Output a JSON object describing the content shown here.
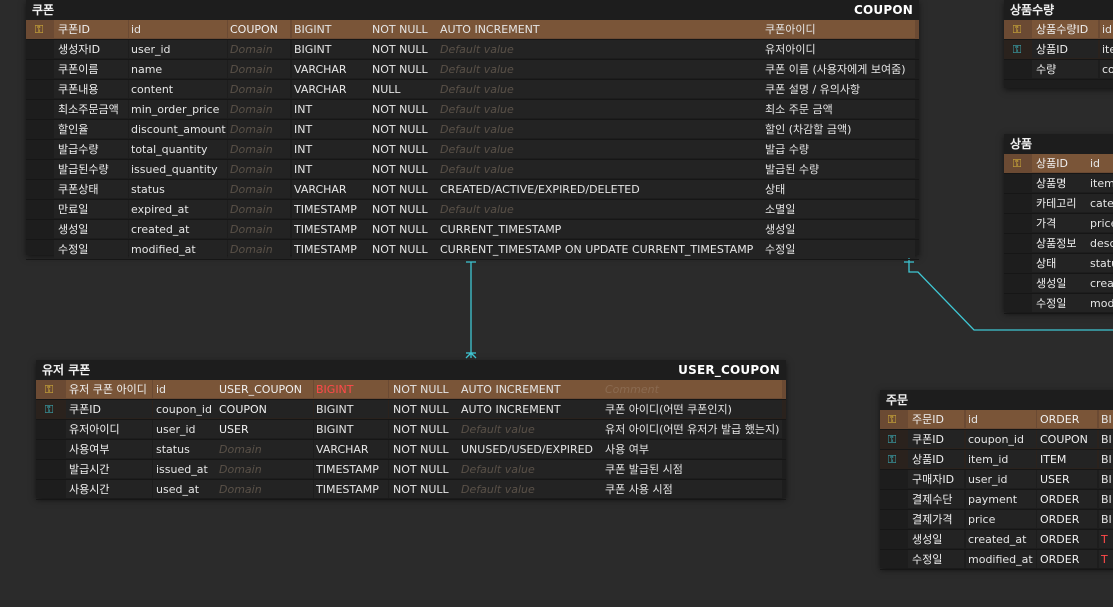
{
  "coupon": {
    "physical": "쿠폰",
    "logical": "COUPON",
    "rows": [
      {
        "key": "pk",
        "ph": "쿠폰ID",
        "col": "id",
        "dom": "COUPON",
        "type": "BIGINT",
        "nn": "NOT NULL",
        "def": "AUTO INCREMENT",
        "cmt": "쿠폰아이디"
      },
      {
        "key": "",
        "ph": "생성자ID",
        "col": "user_id",
        "dom": "Domain",
        "type": "BIGINT",
        "nn": "NOT NULL",
        "def": "Default value",
        "cmt": "유저아이디"
      },
      {
        "key": "",
        "ph": "쿠폰이름",
        "col": "name",
        "dom": "Domain",
        "type": "VARCHAR",
        "nn": "NOT NULL",
        "def": "Default value",
        "cmt": "쿠폰 이름 (사용자에게 보여줌)"
      },
      {
        "key": "",
        "ph": "쿠폰내용",
        "col": "content",
        "dom": "Domain",
        "type": "VARCHAR",
        "nn": "NULL",
        "def": "Default value",
        "cmt": "쿠폰 설명 / 유의사항"
      },
      {
        "key": "",
        "ph": "최소주문금액",
        "col": "min_order_price",
        "dom": "Domain",
        "type": "INT",
        "nn": "NOT NULL",
        "def": "Default value",
        "cmt": "최소 주문 금액"
      },
      {
        "key": "",
        "ph": "할인율",
        "col": "discount_amount",
        "dom": "Domain",
        "type": "INT",
        "nn": "NOT NULL",
        "def": "Default value",
        "cmt": "할인 (차감할 금액)"
      },
      {
        "key": "",
        "ph": "발급수량",
        "col": "total_quantity",
        "dom": "Domain",
        "type": "INT",
        "nn": "NOT NULL",
        "def": "Default value",
        "cmt": "발급 수량"
      },
      {
        "key": "",
        "ph": "발급된수량",
        "col": "issued_quantity",
        "dom": "Domain",
        "type": "INT",
        "nn": "NOT NULL",
        "def": "Default value",
        "cmt": "발급된 수량"
      },
      {
        "key": "",
        "ph": "쿠폰상태",
        "col": "status",
        "dom": "Domain",
        "type": "VARCHAR",
        "nn": "NOT NULL",
        "def": "CREATED/ACTIVE/EXPIRED/DELETED",
        "cmt": "상태"
      },
      {
        "key": "",
        "ph": "만료일",
        "col": "expired_at",
        "dom": "Domain",
        "type": "TIMESTAMP",
        "nn": "NOT NULL",
        "def": "Default value",
        "cmt": "소멸일"
      },
      {
        "key": "",
        "ph": "생성일",
        "col": "created_at",
        "dom": "Domain",
        "type": "TIMESTAMP",
        "nn": "NOT NULL",
        "def": "CURRENT_TIMESTAMP",
        "cmt": "생성일"
      },
      {
        "key": "",
        "ph": "수정일",
        "col": "modified_at",
        "dom": "Domain",
        "type": "TIMESTAMP",
        "nn": "NOT NULL",
        "def": "CURRENT_TIMESTAMP ON UPDATE CURRENT_TIMESTAMP",
        "cmt": "수정일"
      }
    ]
  },
  "user_coupon": {
    "physical": "유저 쿠폰",
    "logical": "USER_COUPON",
    "rows": [
      {
        "key": "pk",
        "ph": "유저 쿠폰 아이디",
        "col": "id",
        "dom": "USER_COUPON",
        "type": "BIGINT",
        "type_red": true,
        "nn": "NOT NULL",
        "def": "AUTO INCREMENT",
        "cmt": "Comment"
      },
      {
        "key": "fk",
        "ph": "쿠폰ID",
        "col": "coupon_id",
        "dom": "COUPON",
        "type": "BIGINT",
        "nn": "NOT NULL",
        "def": "AUTO INCREMENT",
        "cmt": "쿠폰 아이디(어떤 쿠폰인지)"
      },
      {
        "key": "",
        "ph": "유저아이디",
        "col": "user_id",
        "dom": "USER",
        "type": "BIGINT",
        "nn": "NOT NULL",
        "def": "Default value",
        "cmt": "유저 아이디(어떤 유저가 발급 했는지)"
      },
      {
        "key": "",
        "ph": "사용여부",
        "col": "status",
        "dom": "Domain",
        "type": "VARCHAR",
        "nn": "NOT NULL",
        "def": "UNUSED/USED/EXPIRED",
        "cmt": "사용 여부"
      },
      {
        "key": "",
        "ph": "발급시간",
        "col": "issued_at",
        "dom": "Domain",
        "type": "TIMESTAMP",
        "nn": "NOT NULL",
        "def": "Default value",
        "cmt": "쿠폰 발급된 시점"
      },
      {
        "key": "",
        "ph": "사용시간",
        "col": "used_at",
        "dom": "Domain",
        "type": "TIMESTAMP",
        "nn": "NOT NULL",
        "def": "Default value",
        "cmt": "쿠폰 사용 시점"
      }
    ]
  },
  "item_quantity": {
    "physical": "상품수량",
    "rows": [
      {
        "key": "pk",
        "ph": "상품수량ID",
        "col": "id"
      },
      {
        "key": "fk",
        "ph": "상품ID",
        "col": "ite"
      },
      {
        "key": "",
        "ph": "수량",
        "col": "co"
      }
    ]
  },
  "item": {
    "physical": "상품",
    "rows": [
      {
        "key": "pk",
        "ph": "상품ID",
        "col": "id"
      },
      {
        "key": "",
        "ph": "상품명",
        "col": "item"
      },
      {
        "key": "",
        "ph": "카테고리",
        "col": "cate"
      },
      {
        "key": "",
        "ph": "가격",
        "col": "price"
      },
      {
        "key": "",
        "ph": "상품정보",
        "col": "desc"
      },
      {
        "key": "",
        "ph": "상태",
        "col": "statu"
      },
      {
        "key": "",
        "ph": "생성일",
        "col": "crea"
      },
      {
        "key": "",
        "ph": "수정일",
        "col": "mod"
      }
    ]
  },
  "order": {
    "physical": "주문",
    "rows": [
      {
        "key": "pk",
        "ph": "주문ID",
        "col": "id",
        "dom": "ORDER",
        "type": "BI"
      },
      {
        "key": "fk",
        "ph": "쿠폰ID",
        "col": "coupon_id",
        "dom": "COUPON",
        "type": "BI"
      },
      {
        "key": "fk",
        "ph": "상품ID",
        "col": "item_id",
        "dom": "ITEM",
        "type": "BI"
      },
      {
        "key": "",
        "ph": "구매자ID",
        "col": "user_id",
        "dom": "USER",
        "type": "BI"
      },
      {
        "key": "",
        "ph": "결제수단",
        "col": "payment",
        "dom": "ORDER",
        "type": "BI"
      },
      {
        "key": "",
        "ph": "결제가격",
        "col": "price",
        "dom": "ORDER",
        "type": "BI"
      },
      {
        "key": "",
        "ph": "생성일",
        "col": "created_at",
        "dom": "ORDER",
        "type": "T",
        "type_red": true
      },
      {
        "key": "",
        "ph": "수정일",
        "col": "modified_at",
        "dom": "ORDER",
        "type": "T",
        "type_red": true
      }
    ]
  },
  "colors": {
    "pk_row": "#6b4a33",
    "pk_key": "#e6c23a",
    "fk_key": "#3fc7d4",
    "connector": "#3fc7d4",
    "red_type": "#ff4a4a"
  },
  "icons": {
    "pk": "key-icon",
    "fk": "key-icon"
  }
}
